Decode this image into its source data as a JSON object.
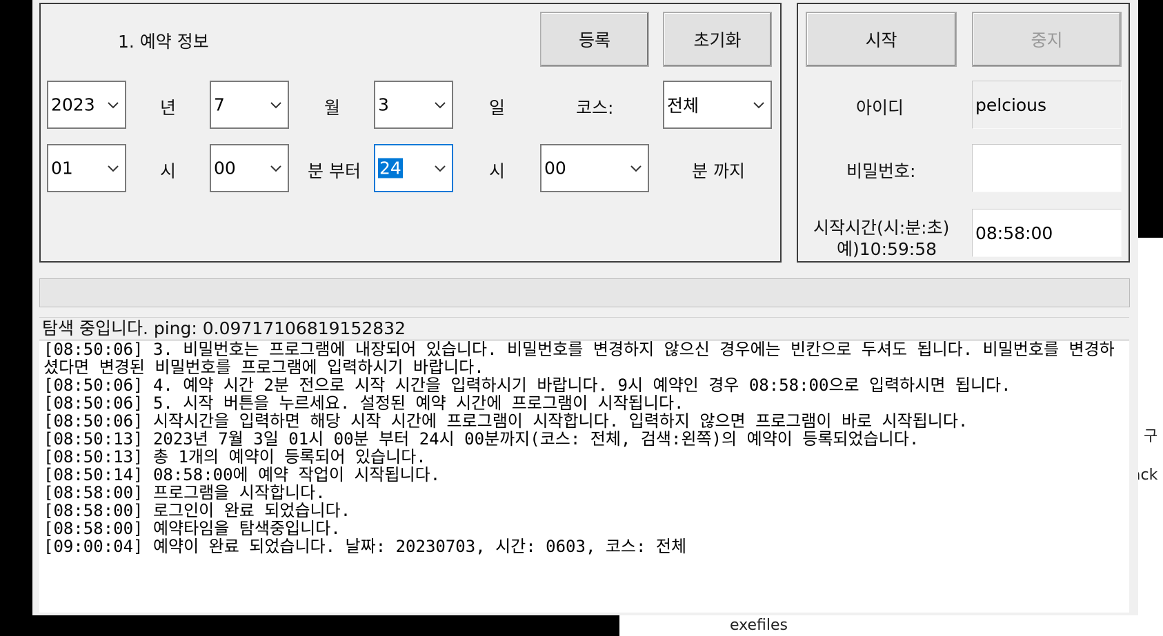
{
  "background_window": {
    "fragments": [
      "ack",
      "구",
      "exefiles"
    ]
  },
  "reservation": {
    "section_title": "1. 예약 정보",
    "register_button": "등록",
    "reset_button": "초기화",
    "year": {
      "value": "2023",
      "unit": "년"
    },
    "month": {
      "value": "7",
      "unit": "월"
    },
    "day": {
      "value": "3",
      "unit": "일"
    },
    "course": {
      "label": "코스:",
      "value": "전체"
    },
    "start_hour": {
      "value": "01",
      "unit": "시"
    },
    "start_minute": {
      "value": "00",
      "unit": "분 부터"
    },
    "end_hour": {
      "value": "24",
      "unit": "시"
    },
    "end_minute": {
      "value": "00",
      "unit": "분 까지"
    }
  },
  "login": {
    "start_button": "시작",
    "stop_button": "중지",
    "id_label": "아이디",
    "id_value": "pelcious",
    "password_label": "비밀번호:",
    "password_value": "",
    "start_time_label": "시작시간(시:분:초)",
    "start_time_example": "예)10:59:58",
    "start_time_value": "08:58:00"
  },
  "status": {
    "text": "탐색 중입니다. ping: 0.09717106819152832"
  },
  "log": [
    "[08:50:06] 3. 비밀번호는 프로그램에 내장되어 있습니다. 비밀번호를 변경하지 않으신 경우에는 빈칸으로 두셔도 됩니다. 비밀번호를 변경하셨다면 변경된 비밀번호를 프로그램에 입력하시기 바랍니다.",
    "[08:50:06] 4. 예약 시간 2분 전으로 시작 시간을 입력하시기 바랍니다. 9시 예약인 경우 08:58:00으로 입력하시면 됩니다.",
    "[08:50:06] 5. 시작 버튼을 누르세요. 설정된 예약 시간에 프로그램이 시작됩니다.",
    "[08:50:06] 시작시간을 입력하면 해당 시작 시간에 프로그램이 시작합니다. 입력하지 않으면 프로그램이 바로 시작됩니다.",
    "[08:50:13] 2023년 7월 3일 01시 00분 부터 24시 00분까지(코스: 전체, 검색:왼쪽)의 예약이 등록되었습니다.",
    "[08:50:13] 총 1개의 예약이 등록되어 있습니다.",
    "[08:50:14] 08:58:00에 예약 작업이 시작됩니다.",
    "[08:58:00] 프로그램을 시작합니다.",
    "[08:58:00] 로그인이 완료 되었습니다.",
    "[08:58:00] 예약타임을 탐색중입니다.",
    "[09:00:04] 예약이 완료 되었습니다. 날짜: 20230703, 시간: 0603, 코스: 전체"
  ]
}
